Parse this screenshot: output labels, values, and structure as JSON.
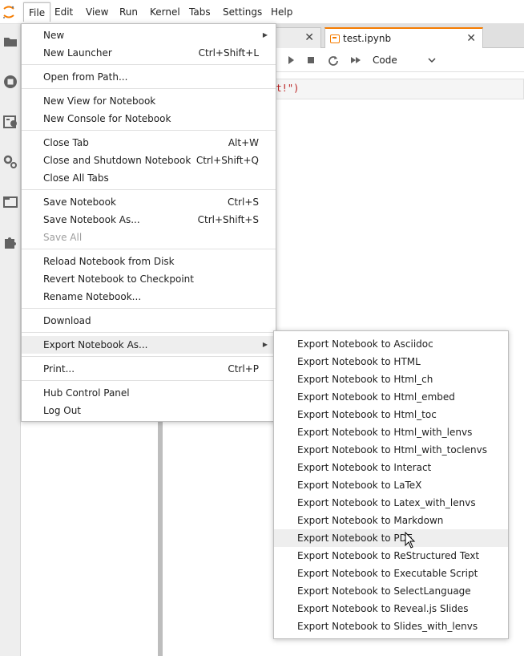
{
  "menubar": {
    "items": [
      "File",
      "Edit",
      "View",
      "Run",
      "Kernel",
      "Tabs",
      "Settings",
      "Help"
    ]
  },
  "sidebar": {
    "icons": [
      "folder-icon",
      "running-icon",
      "commands-icon",
      "property-inspector-icon",
      "tabs-icon",
      "extension-icon"
    ]
  },
  "tabs": [
    {
      "label": ""
    },
    {
      "label": "test.ipynb"
    }
  ],
  "toolbar": {
    "cell_type": "Code"
  },
  "cell": {
    "code_visible": "est!\")"
  },
  "file_menu": {
    "groups": [
      [
        {
          "label": "New",
          "shortcut": "",
          "submenu": true
        },
        {
          "label": "New Launcher",
          "shortcut": "Ctrl+Shift+L"
        }
      ],
      [
        {
          "label": "Open from Path...",
          "shortcut": ""
        }
      ],
      [
        {
          "label": "New View for Notebook",
          "shortcut": ""
        },
        {
          "label": "New Console for Notebook",
          "shortcut": ""
        }
      ],
      [
        {
          "label": "Close Tab",
          "shortcut": "Alt+W"
        },
        {
          "label": "Close and Shutdown Notebook",
          "shortcut": "Ctrl+Shift+Q"
        },
        {
          "label": "Close All Tabs",
          "shortcut": ""
        }
      ],
      [
        {
          "label": "Save Notebook",
          "shortcut": "Ctrl+S"
        },
        {
          "label": "Save Notebook As...",
          "shortcut": "Ctrl+Shift+S"
        },
        {
          "label": "Save All",
          "shortcut": "",
          "disabled": true
        }
      ],
      [
        {
          "label": "Reload Notebook from Disk",
          "shortcut": ""
        },
        {
          "label": "Revert Notebook to Checkpoint",
          "shortcut": ""
        },
        {
          "label": "Rename Notebook...",
          "shortcut": ""
        }
      ],
      [
        {
          "label": "Download",
          "shortcut": ""
        }
      ],
      [
        {
          "label": "Export Notebook As...",
          "shortcut": "",
          "submenu": true,
          "highlight": true
        }
      ],
      [
        {
          "label": "Print...",
          "shortcut": "Ctrl+P"
        }
      ],
      [
        {
          "label": "Hub Control Panel",
          "shortcut": ""
        },
        {
          "label": "Log Out",
          "shortcut": ""
        }
      ]
    ]
  },
  "export_menu": {
    "items": [
      "Export Notebook to Asciidoc",
      "Export Notebook to HTML",
      "Export Notebook to Html_ch",
      "Export Notebook to Html_embed",
      "Export Notebook to Html_toc",
      "Export Notebook to Html_with_lenvs",
      "Export Notebook to Html_with_toclenvs",
      "Export Notebook to Interact",
      "Export Notebook to LaTeX",
      "Export Notebook to Latex_with_lenvs",
      "Export Notebook to Markdown",
      "Export Notebook to PDF",
      "Export Notebook to ReStructured Text",
      "Export Notebook to Executable Script",
      "Export Notebook to SelectLanguage",
      "Export Notebook to Reveal.js Slides",
      "Export Notebook to Slides_with_lenvs"
    ],
    "highlighted": "Export Notebook to PDF"
  },
  "colors": {
    "accent": "#f57c00",
    "menu_highlight": "#eeeeee",
    "disabled_text": "#9e9e9e",
    "string_code": "#ba2121"
  }
}
